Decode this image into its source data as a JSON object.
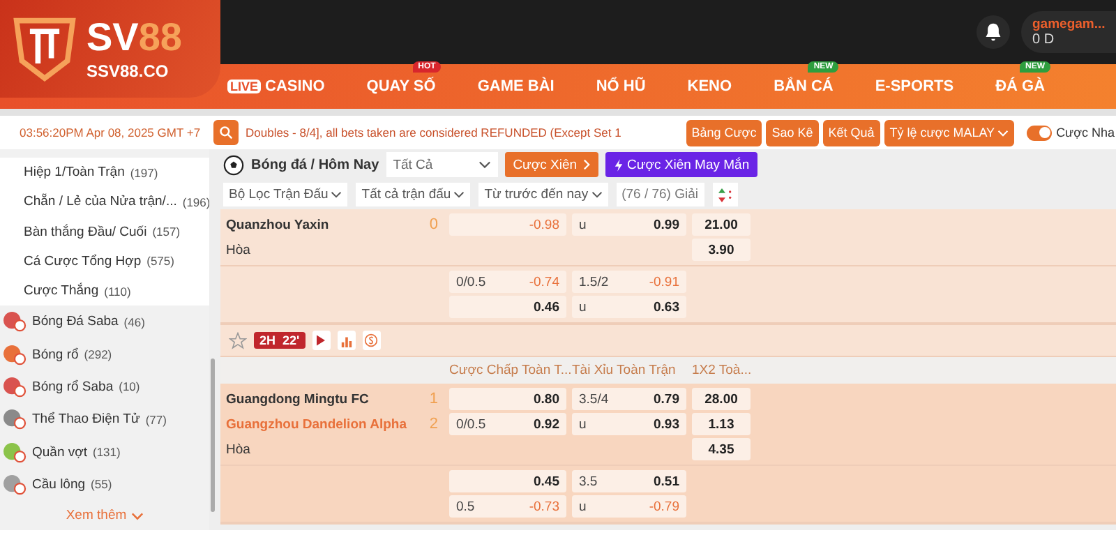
{
  "logo": {
    "word": "SV",
    "accent": "88",
    "domain": "SSV88.CO"
  },
  "account": {
    "username": "gamegam...",
    "balance": "0 D"
  },
  "nav": [
    {
      "label": "CASINO",
      "tag": "LIVE"
    },
    {
      "label": "QUAY SỐ",
      "badge": {
        "text": "HOT",
        "color": "#d8262c"
      }
    },
    {
      "label": "GAME BÀI"
    },
    {
      "label": "NỔ HŨ"
    },
    {
      "label": "KENO"
    },
    {
      "label": "BẮN CÁ",
      "badge": {
        "text": "NEW",
        "color": "#2e9e3e"
      }
    },
    {
      "label": "E-SPORTS"
    },
    {
      "label": "ĐÁ GÀ",
      "badge": {
        "text": "NEW",
        "color": "#2e9e3e"
      }
    }
  ],
  "toolbar": {
    "clock": "03:56:20PM Apr 08, 2025 GMT +7",
    "ticker": "Doubles - 8/4], all bets taken are considered REFUNDED (Except Set 1",
    "buttons": [
      "Bảng Cược",
      "Sao Kê",
      "Kết Quả"
    ],
    "odds_type": "Tỷ lệ cược MALAY",
    "toggle": {
      "label": "Cược Nha",
      "on": true
    }
  },
  "sidebar": {
    "items": [
      {
        "label": "Hiệp 1/Toàn Trận",
        "count": "(197)",
        "kind": "market"
      },
      {
        "label": "Chẵn / Lẻ của Nửa trận/...",
        "count": "(196)",
        "kind": "market"
      },
      {
        "label": "Bàn thắng Đầu/ Cuối",
        "count": "(157)",
        "kind": "market"
      },
      {
        "label": "Cá Cược Tổng Hợp",
        "count": "(575)",
        "kind": "market"
      },
      {
        "label": "Cược Thắng",
        "count": "(110)",
        "kind": "market"
      },
      {
        "label": "Bóng Đá Saba",
        "count": "(46)",
        "kind": "sport",
        "color": "#d9534f"
      },
      {
        "label": "Bóng rổ",
        "count": "(292)",
        "kind": "sport",
        "color": "#e8703a"
      },
      {
        "label": "Bóng rổ Saba",
        "count": "(10)",
        "kind": "sport",
        "color": "#d9534f"
      },
      {
        "label": "Thể Thao Điện Tử",
        "count": "(77)",
        "kind": "sport",
        "color": "#8a8a8a"
      },
      {
        "label": "Quần vợt",
        "count": "(131)",
        "kind": "sport",
        "color": "#8bc34a"
      },
      {
        "label": "Cầu lông",
        "count": "(55)",
        "kind": "sport",
        "color": "#a0a0a0"
      }
    ],
    "more": "Xem thêm"
  },
  "market": {
    "title": "Bóng đá / Hôm Nay",
    "select": "Tất Cả",
    "parlay": "Cược Xiên",
    "lucky": "Cược Xiên May Mắn",
    "filters": [
      "Bộ Lọc Trận Đấu",
      "Tất cả trận đấu",
      "Từ trước đến nay"
    ],
    "leagues": "(76 / 76) Giải"
  },
  "blocks": [
    {
      "rows": [
        {
          "kind": "team",
          "team": "Quanzhou Yaxin",
          "score": "0",
          "highlight": false,
          "hdp": {
            "odds": "-0.98",
            "negative": true
          },
          "ou": {
            "line": "u",
            "odds": "0.99",
            "negative": false
          },
          "x12": "21.00"
        },
        {
          "kind": "draw",
          "team": "Hòa",
          "x12": "3.90"
        }
      ],
      "alt_rows": [
        {
          "hdp": {
            "line": "0/0.5",
            "odds": "-0.74",
            "negative": true
          },
          "ou": {
            "line": "1.5/2",
            "odds": "-0.91",
            "negative": true
          }
        },
        {
          "hdp": {
            "odds": "0.46",
            "negative": false
          },
          "ou": {
            "line": "u",
            "odds": "0.63",
            "negative": false
          }
        }
      ]
    },
    {
      "status": {
        "starred": false,
        "period": "2H",
        "minute": "22'"
      },
      "headers": [
        "Cược Chấp Toàn T...",
        "Tài Xỉu Toàn Trận",
        "1X2 Toà..."
      ],
      "rows": [
        {
          "kind": "team",
          "team": "Guangdong Mingtu FC",
          "score": "1",
          "highlight": false,
          "hdp": {
            "odds": "0.80",
            "negative": false
          },
          "ou": {
            "line": "3.5/4",
            "odds": "0.79",
            "negative": false
          },
          "x12": "28.00"
        },
        {
          "kind": "team",
          "team": "Guangzhou Dandelion Alpha",
          "score": "2",
          "highlight": true,
          "hdp": {
            "line": "0/0.5",
            "odds": "0.92",
            "negative": false
          },
          "ou": {
            "line": "u",
            "odds": "0.93",
            "negative": false
          },
          "x12": "1.13"
        },
        {
          "kind": "draw",
          "team": "Hòa",
          "x12": "4.35"
        }
      ],
      "alt_rows": [
        {
          "hdp": {
            "odds": "0.45",
            "negative": false
          },
          "ou": {
            "line": "3.5",
            "odds": "0.51",
            "negative": false
          }
        },
        {
          "hdp": {
            "line": "0.5",
            "odds": "-0.73",
            "negative": true
          },
          "ou": {
            "line": "u",
            "odds": "-0.79",
            "negative": true
          }
        }
      ]
    }
  ]
}
